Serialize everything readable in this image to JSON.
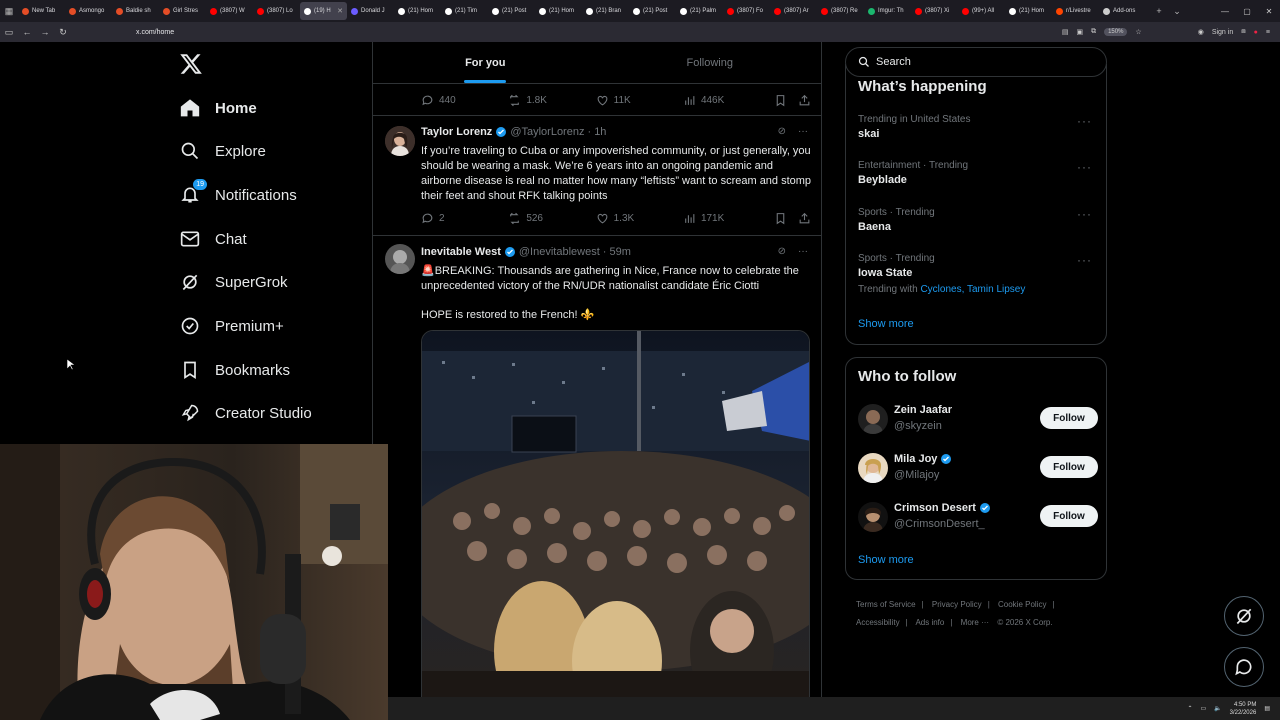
{
  "browser": {
    "tabs": [
      {
        "label": "New Tab",
        "color": "#e44d26"
      },
      {
        "label": "Asmongo",
        "color": "#e44d26"
      },
      {
        "label": "Baldie sh",
        "color": "#e44d26"
      },
      {
        "label": "Girl Stres",
        "color": "#e44d26"
      },
      {
        "label": "(3807) W",
        "color": "#ff0000"
      },
      {
        "label": "(3807) Lo",
        "color": "#ff0000"
      },
      {
        "label": "(19) H",
        "color": "#ffffff",
        "active": true
      },
      {
        "label": "Donald J",
        "color": "#6b5cff"
      },
      {
        "label": "(21) Hom",
        "color": "#ffffff"
      },
      {
        "label": "(21) Tim",
        "color": "#ffffff"
      },
      {
        "label": "(21) Post",
        "color": "#ffffff"
      },
      {
        "label": "(21) Hom",
        "color": "#ffffff"
      },
      {
        "label": "(21) Bran",
        "color": "#ffffff"
      },
      {
        "label": "(21) Post",
        "color": "#ffffff"
      },
      {
        "label": "(21) Palm",
        "color": "#ffffff"
      },
      {
        "label": "(3807) Fo",
        "color": "#ff0000"
      },
      {
        "label": "(3807) Ar",
        "color": "#ff0000"
      },
      {
        "label": "(3807) Re",
        "color": "#ff0000"
      },
      {
        "label": "Imgur: Th",
        "color": "#1bb76e"
      },
      {
        "label": "(3807) Xi",
        "color": "#ff0000"
      },
      {
        "label": "(99+) All",
        "color": "#ff0000"
      },
      {
        "label": "(21) Hom",
        "color": "#ffffff"
      },
      {
        "label": "r/Livestre",
        "color": "#ff4500"
      },
      {
        "label": "Add-ons",
        "color": "#cccccc"
      }
    ],
    "url": "x.com/home",
    "zoom": "150%",
    "sign_in": "Sign in"
  },
  "nav": {
    "items": [
      {
        "label": "Home",
        "icon": "home-icon"
      },
      {
        "label": "Explore",
        "icon": "search-icon"
      },
      {
        "label": "Notifications",
        "icon": "bell-icon",
        "badge": "19"
      },
      {
        "label": "Chat",
        "icon": "mail-icon"
      },
      {
        "label": "SuperGrok",
        "icon": "grok-icon"
      },
      {
        "label": "Premium+",
        "icon": "verified-icon"
      },
      {
        "label": "Bookmarks",
        "icon": "bookmark-icon"
      },
      {
        "label": "Creator Studio",
        "icon": "rocket-icon"
      }
    ]
  },
  "feed": {
    "tabs": [
      "For you",
      "Following"
    ],
    "top_actions": {
      "replies": "440",
      "reposts": "1.8K",
      "likes": "11K",
      "views": "446K"
    },
    "posts": [
      {
        "name": "Taylor Lorenz",
        "handle": "@TaylorLorenz",
        "time": "· 1h",
        "text": "If you’re traveling to Cuba or any impoverished community, or just generally, you should be wearing a mask. We’re 6 years into an ongoing pandemic and airborne disease is real no matter how many “leftists” want to scream and stomp their feet and shout RFK talking points",
        "replies": "2",
        "reposts": "526",
        "likes": "1.3K",
        "views": "171K"
      },
      {
        "name": "Inevitable West",
        "handle": "@Inevitablewest",
        "time": "· 59m",
        "text": "🚨BREAKING: Thousands are gathering in Nice, France now to celebrate the unprecedented victory of the RN/UDR nationalist candidate Éric Ciotti",
        "text2": "HOPE is restored to the French! ⚜️"
      }
    ]
  },
  "search": {
    "placeholder": "Search"
  },
  "trending": {
    "title": "What’s happening",
    "items": [
      {
        "meta": "Trending in United States",
        "topic": "skai"
      },
      {
        "meta": "Entertainment · Trending",
        "topic": "Beyblade"
      },
      {
        "meta": "Sports · Trending",
        "topic": "Baena"
      },
      {
        "meta": "Sports · Trending",
        "topic": "Iowa State",
        "with_label": "Trending with",
        "with_links": [
          "Cyclones",
          "Tamin Lipsey"
        ]
      }
    ],
    "show_more": "Show more"
  },
  "who_to_follow": {
    "title": "Who to follow",
    "users": [
      {
        "name": "Zein Jaafar",
        "handle": "@skyzein",
        "verified": false
      },
      {
        "name": "Mila Joy",
        "handle": "@Milajoy",
        "verified": true
      },
      {
        "name": "Crimson Desert",
        "handle": "@CrimsonDesert_",
        "verified": true
      }
    ],
    "follow_label": "Follow",
    "show_more": "Show more"
  },
  "footer": {
    "links": [
      "Terms of Service",
      "|",
      "Privacy Policy",
      "|",
      "Cookie Policy",
      "|",
      "Accessibility",
      "|",
      "Ads info",
      "|",
      "More ···",
      "© 2026 X Corp."
    ]
  },
  "taskbar": {
    "time": "4:50 PM",
    "date": "3/22/2026"
  }
}
